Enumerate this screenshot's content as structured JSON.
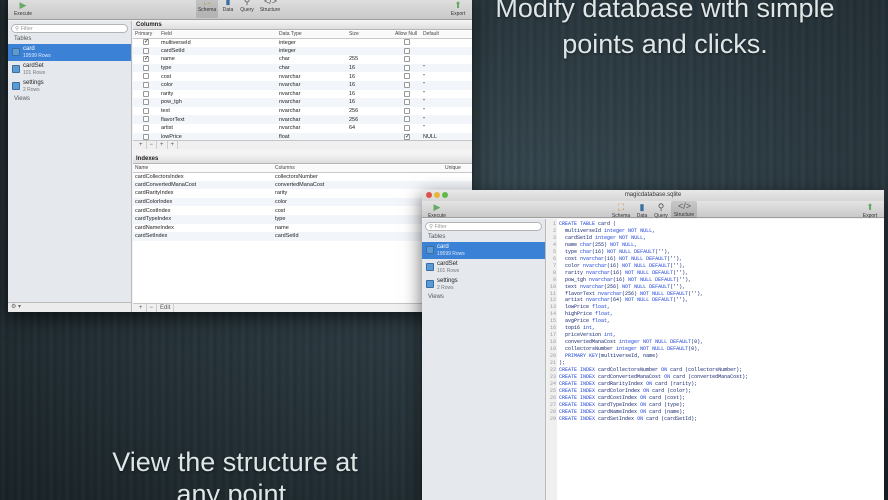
{
  "headline_top": "Modify database with simple points and clicks.",
  "headline_bottom": "View the structure at any point.",
  "window1": {
    "toolbar": {
      "execute": "Execute",
      "schema": "Schema",
      "data": "Data",
      "query": "Query",
      "structure": "Structure",
      "export": "Export"
    },
    "filter_placeholder": "Filter",
    "tables_header": "Tables",
    "tables": [
      {
        "name": "card",
        "rows": "19599 Rows"
      },
      {
        "name": "cardSet",
        "rows": "101 Rows"
      },
      {
        "name": "settings",
        "rows": "2 Rows"
      }
    ],
    "views_header": "Views",
    "columns_title": "Columns",
    "columns_headers": [
      "Primary",
      "Field",
      "Data Type",
      "Size",
      "Allow Null",
      "Default"
    ],
    "columns": [
      {
        "primary": true,
        "field": "multiverseId",
        "type": "integer",
        "size": "",
        "allow_null": false,
        "default": ""
      },
      {
        "primary": false,
        "field": "cardSetId",
        "type": "integer",
        "size": "",
        "allow_null": false,
        "default": ""
      },
      {
        "primary": true,
        "field": "name",
        "type": "char",
        "size": "255",
        "allow_null": false,
        "default": ""
      },
      {
        "primary": false,
        "field": "type",
        "type": "char",
        "size": "16",
        "allow_null": false,
        "default": "''"
      },
      {
        "primary": false,
        "field": "cost",
        "type": "nvarchar",
        "size": "16",
        "allow_null": false,
        "default": "''"
      },
      {
        "primary": false,
        "field": "color",
        "type": "nvarchar",
        "size": "16",
        "allow_null": false,
        "default": "''"
      },
      {
        "primary": false,
        "field": "rarity",
        "type": "nvarchar",
        "size": "16",
        "allow_null": false,
        "default": "''"
      },
      {
        "primary": false,
        "field": "pow_tgh",
        "type": "nvarchar",
        "size": "16",
        "allow_null": false,
        "default": "''"
      },
      {
        "primary": false,
        "field": "text",
        "type": "nvarchar",
        "size": "256",
        "allow_null": false,
        "default": "''"
      },
      {
        "primary": false,
        "field": "flavorText",
        "type": "nvarchar",
        "size": "256",
        "allow_null": false,
        "default": "''"
      },
      {
        "primary": false,
        "field": "artist",
        "type": "nvarchar",
        "size": "64",
        "allow_null": false,
        "default": "''"
      },
      {
        "primary": false,
        "field": "lowPrice",
        "type": "float",
        "size": "",
        "allow_null": true,
        "default": "NULL"
      }
    ],
    "col_buttons": [
      "+",
      "−",
      "+",
      "+"
    ],
    "indexes_title": "Indexes",
    "indexes_headers": [
      "Name",
      "Columns",
      "Unique"
    ],
    "indexes": [
      {
        "name": "cardCollectorsIndex",
        "columns": "collectorsNumber"
      },
      {
        "name": "cardConvertedManaCost",
        "columns": "convertedManaCost"
      },
      {
        "name": "cardRarityIndex",
        "columns": "rarity"
      },
      {
        "name": "cardColorIndex",
        "columns": "color"
      },
      {
        "name": "cardCostIndex",
        "columns": "cost"
      },
      {
        "name": "cardTypeIndex",
        "columns": "type"
      },
      {
        "name": "cardNameIndex",
        "columns": "name"
      },
      {
        "name": "cardSetIndex",
        "columns": "cardSetId"
      }
    ],
    "idx_buttons": [
      "+",
      "−",
      "Edit"
    ],
    "gear": "⚙ ▾"
  },
  "window2": {
    "title": "magicdatabase.sqlite",
    "toolbar": {
      "execute": "Execute",
      "schema": "Schema",
      "data": "Data",
      "query": "Query",
      "structure": "Structure",
      "export": "Export"
    },
    "filter_placeholder": "Filter",
    "tables_header": "Tables",
    "tables": [
      {
        "name": "card",
        "rows": "19599 Rows"
      },
      {
        "name": "cardSet",
        "rows": "101 Rows"
      },
      {
        "name": "settings",
        "rows": "2 Rows"
      }
    ],
    "views_header": "Views",
    "sql_lines": [
      "CREATE TABLE card (",
      "  multiverseId integer NOT NULL,",
      "  cardSetId integer NOT NULL,",
      "  name char(255) NOT NULL,",
      "  type char(16) NOT NULL DEFAULT(''),",
      "  cost nvarchar(16) NOT NULL DEFAULT(''),",
      "  color nvarchar(16) NOT NULL DEFAULT(''),",
      "  rarity nvarchar(16) NOT NULL DEFAULT(''),",
      "  pow_tgh nvarchar(16) NOT NULL DEFAULT(''),",
      "  text nvarchar(256) NOT NULL DEFAULT(''),",
      "  flavorText nvarchar(256) NOT NULL DEFAULT(''),",
      "  artist nvarchar(64) NOT NULL DEFAULT(''),",
      "  lowPrice float,",
      "  highPrice float,",
      "  avgPrice float,",
      "  top16 int,",
      "  priceVersion int,",
      "  convertedManaCost integer NOT NULL DEFAULT(0),",
      "  collectorsNumber integer NOT NULL DEFAULT(0),",
      "  PRIMARY KEY(multiverseId, name)",
      ");",
      "CREATE INDEX cardCollectorsNumber ON card (collectorsNumber);",
      "CREATE INDEX cardConvertedManaCost ON card (convertedManaCost);",
      "CREATE INDEX cardRarityIndex ON card (rarity);",
      "CREATE INDEX cardColorIndex ON card (color);",
      "CREATE INDEX cardCostIndex ON card (cost);",
      "CREATE INDEX cardTypeIndex ON card (type);",
      "CREATE INDEX cardNameIndex ON card (name);",
      "CREATE INDEX cardSetIndex ON card (cardSetId);"
    ]
  },
  "colors": {
    "selection": "#3b82d6",
    "keyword": "#1a3fd6",
    "identifier": "#0b1d6b"
  }
}
